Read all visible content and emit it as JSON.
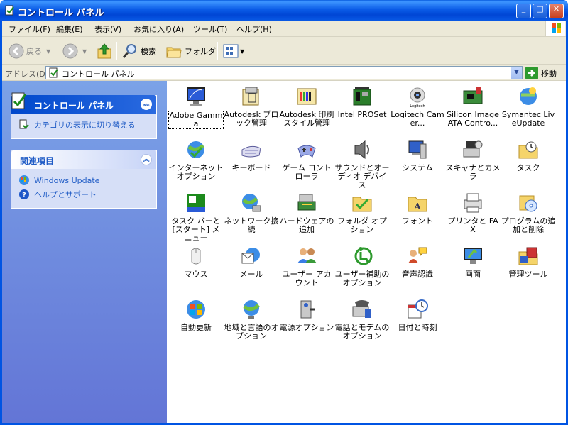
{
  "window": {
    "title": "コントロール パネル",
    "min": "_",
    "max": "□",
    "close": "✕"
  },
  "menu": [
    "ファイル(F)",
    "編集(E)",
    "表示(V)",
    "お気に入り(A)",
    "ツール(T)",
    "ヘルプ(H)"
  ],
  "toolbar": {
    "back": "戻る",
    "search": "検索",
    "folders": "フォルダ"
  },
  "address": {
    "label": "アドレス(D)",
    "value": "コントロール パネル",
    "go": "移動"
  },
  "sidebar": {
    "control_panel": {
      "title": "コントロール パネル",
      "link": "カテゴリの表示に切り替える"
    },
    "related": {
      "title": "関連項目",
      "links": [
        "Windows Update",
        "ヘルプとサポート"
      ]
    }
  },
  "items": [
    {
      "label": "Adobe Gamma",
      "icon": "monitor-gamma-icon"
    },
    {
      "label": "Autodesk ブロック管理",
      "icon": "autodesk-block-icon"
    },
    {
      "label": "Autodesk 印刷スタイル管理",
      "icon": "autodesk-print-style-icon"
    },
    {
      "label": "Intel PROSet",
      "icon": "intel-network-icon"
    },
    {
      "label": "Logitech Camer...",
      "icon": "logitech-camera-icon"
    },
    {
      "label": "Silicon Image ATA Contro...",
      "icon": "silicon-image-icon"
    },
    {
      "label": "Symantec LiveUpdate",
      "icon": "symantec-icon"
    },
    {
      "label": "インターネット オプション",
      "icon": "internet-options-icon"
    },
    {
      "label": "キーボード",
      "icon": "keyboard-icon"
    },
    {
      "label": "ゲーム コントローラ",
      "icon": "game-controller-icon"
    },
    {
      "label": "サウンドとオーディオ デバイス",
      "icon": "speaker-icon"
    },
    {
      "label": "システム",
      "icon": "system-icon"
    },
    {
      "label": "スキャナとカメラ",
      "icon": "scanner-camera-icon"
    },
    {
      "label": "タスク",
      "icon": "scheduled-tasks-icon"
    },
    {
      "label": "タスク バーと [スタート] メニュー",
      "icon": "taskbar-icon"
    },
    {
      "label": "ネットワーク接続",
      "icon": "network-icon"
    },
    {
      "label": "ハードウェアの追加",
      "icon": "add-hardware-icon"
    },
    {
      "label": "フォルダ オプション",
      "icon": "folder-options-icon"
    },
    {
      "label": "フォント",
      "icon": "fonts-icon"
    },
    {
      "label": "プリンタと FAX",
      "icon": "printer-icon"
    },
    {
      "label": "プログラムの追加と削除",
      "icon": "add-remove-programs-icon"
    },
    {
      "label": "マウス",
      "icon": "mouse-icon"
    },
    {
      "label": "メール",
      "icon": "mail-icon"
    },
    {
      "label": "ユーザー アカウント",
      "icon": "user-accounts-icon"
    },
    {
      "label": "ユーザー補助のオプション",
      "icon": "accessibility-icon"
    },
    {
      "label": "音声認識",
      "icon": "speech-icon"
    },
    {
      "label": "画面",
      "icon": "display-icon"
    },
    {
      "label": "管理ツール",
      "icon": "admin-tools-icon"
    },
    {
      "label": "自動更新",
      "icon": "automatic-updates-icon"
    },
    {
      "label": "地域と言語のオプション",
      "icon": "globe-icon"
    },
    {
      "label": "電源オプション",
      "icon": "power-options-icon"
    },
    {
      "label": "電話とモデムのオプション",
      "icon": "phone-modem-icon"
    },
    {
      "label": "日付と時刻",
      "icon": "date-time-icon"
    }
  ]
}
